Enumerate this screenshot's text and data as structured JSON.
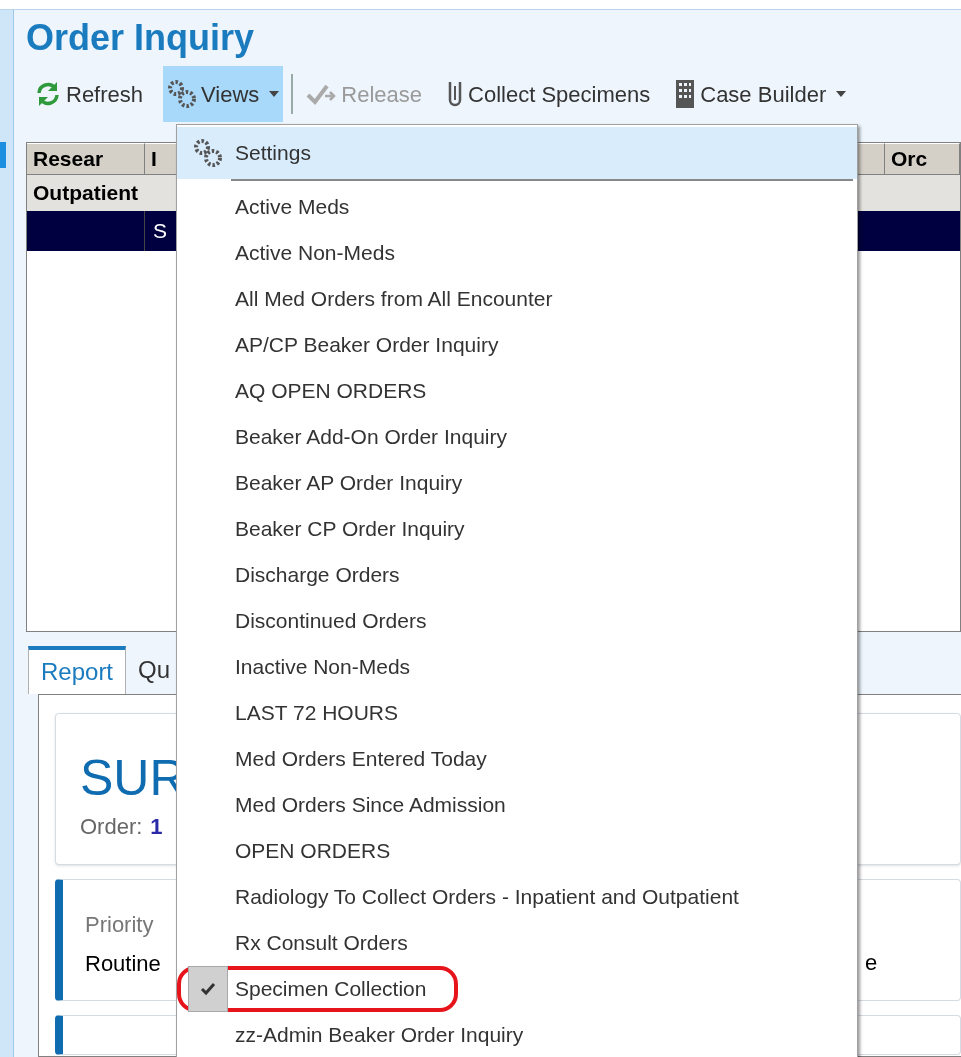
{
  "title": "Order Inquiry",
  "toolbar": [
    {
      "label": "Refresh",
      "kind": "refresh",
      "disabled": false,
      "selected": false,
      "dropdown": false
    },
    {
      "label": "Views",
      "kind": "views",
      "disabled": false,
      "selected": true,
      "dropdown": true
    },
    {
      "label": "Release",
      "kind": "release",
      "disabled": true,
      "selected": false,
      "dropdown": false
    },
    {
      "label": "Collect Specimens",
      "kind": "collect",
      "disabled": false,
      "selected": false,
      "dropdown": false
    },
    {
      "label": "Case Builder",
      "kind": "case",
      "disabled": false,
      "selected": false,
      "dropdown": true
    }
  ],
  "grid": {
    "columns": [
      "Resear",
      "I",
      "Orc"
    ],
    "group_row": "Outpatient",
    "rows": [
      {
        "column_2": "S",
        "selected": true
      }
    ]
  },
  "tabs": [
    {
      "label": "Report",
      "selected": true
    },
    {
      "label": "Qu",
      "selected": false
    }
  ],
  "report": {
    "heading": "SUR",
    "order_label": "Order:",
    "order_value": "1",
    "fields": [
      {
        "label": "Priority",
        "value": "Routine",
        "trailing": "e"
      }
    ]
  },
  "menu": [
    {
      "label": "Settings",
      "kind": "settings",
      "highlighted": true,
      "checked": false,
      "circled": false
    },
    {
      "label": "Active Meds",
      "kind": "item",
      "highlighted": false,
      "checked": false,
      "circled": false
    },
    {
      "label": "Active Non-Meds",
      "kind": "item",
      "highlighted": false,
      "checked": false,
      "circled": false
    },
    {
      "label": "All Med Orders from All Encounter",
      "kind": "item",
      "highlighted": false,
      "checked": false,
      "circled": false
    },
    {
      "label": "AP/CP Beaker Order Inquiry",
      "kind": "item",
      "highlighted": false,
      "checked": false,
      "circled": false
    },
    {
      "label": "AQ OPEN ORDERS",
      "kind": "item",
      "highlighted": false,
      "checked": false,
      "circled": false
    },
    {
      "label": "Beaker Add-On Order Inquiry",
      "kind": "item",
      "highlighted": false,
      "checked": false,
      "circled": false
    },
    {
      "label": "Beaker AP Order Inquiry",
      "kind": "item",
      "highlighted": false,
      "checked": false,
      "circled": false
    },
    {
      "label": "Beaker CP Order Inquiry",
      "kind": "item",
      "highlighted": false,
      "checked": false,
      "circled": false
    },
    {
      "label": "Discharge Orders",
      "kind": "item",
      "highlighted": false,
      "checked": false,
      "circled": false
    },
    {
      "label": "Discontinued Orders",
      "kind": "item",
      "highlighted": false,
      "checked": false,
      "circled": false
    },
    {
      "label": "Inactive Non-Meds",
      "kind": "item",
      "highlighted": false,
      "checked": false,
      "circled": false
    },
    {
      "label": "LAST 72 HOURS",
      "kind": "item",
      "highlighted": false,
      "checked": false,
      "circled": false
    },
    {
      "label": "Med Orders Entered Today",
      "kind": "item",
      "highlighted": false,
      "checked": false,
      "circled": false
    },
    {
      "label": "Med Orders Since Admission",
      "kind": "item",
      "highlighted": false,
      "checked": false,
      "circled": false
    },
    {
      "label": "OPEN ORDERS",
      "kind": "item",
      "highlighted": false,
      "checked": false,
      "circled": false
    },
    {
      "label": "Radiology To Collect Orders - Inpatient and Outpatient",
      "kind": "item",
      "highlighted": false,
      "checked": false,
      "circled": false
    },
    {
      "label": "Rx Consult Orders",
      "kind": "item",
      "highlighted": false,
      "checked": false,
      "circled": false
    },
    {
      "label": "Specimen Collection",
      "kind": "item",
      "highlighted": false,
      "checked": true,
      "circled": true
    },
    {
      "label": "zz-Admin Beaker Order Inquiry",
      "kind": "item",
      "highlighted": false,
      "checked": false,
      "circled": false
    }
  ]
}
